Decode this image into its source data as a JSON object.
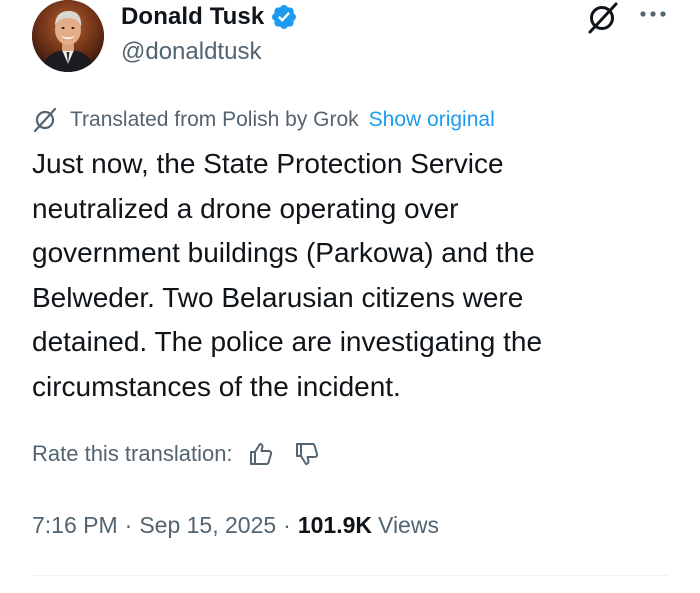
{
  "author": {
    "display_name": "Donald Tusk",
    "handle": "@donaldtusk",
    "avatar_icon": "profile-photo",
    "verified_icon": "verified-badge-icon",
    "verified_color": "#1d9bf0"
  },
  "header_actions": {
    "grok_icon": "grok-icon",
    "more_icon": "more-dots-icon"
  },
  "translation": {
    "label": "Translated from Polish by Grok",
    "show_original": "Show original",
    "link_color": "#1d9bf0"
  },
  "tweet": {
    "text": "Just now, the State Protection Service\nneutralized a drone operating over\ngovernment buildings (Parkowa) and the\nBelweder. Two Belarusian citizens were\ndetained. The police are investigating the\ncircumstances of the incident."
  },
  "rating": {
    "label": "Rate this translation:",
    "thumbs_up_icon": "thumbs-up-icon",
    "thumbs_down_icon": "thumbs-down-icon"
  },
  "meta": {
    "time": "7:16 PM",
    "separator": "·",
    "date": "Sep 15, 2025",
    "views_count": "101.9K",
    "views_label": "Views"
  },
  "colors": {
    "text_primary": "#0f1419",
    "text_secondary": "#536471"
  }
}
